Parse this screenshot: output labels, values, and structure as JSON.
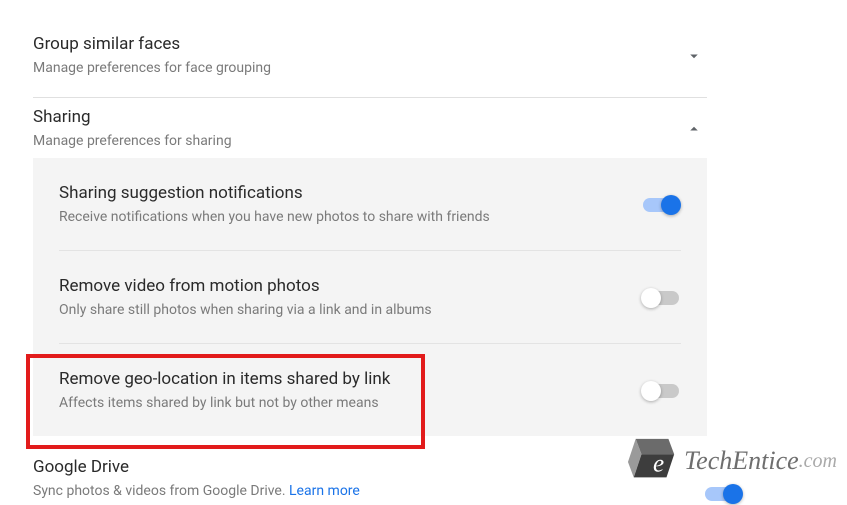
{
  "faces": {
    "title": "Group similar faces",
    "subtitle": "Manage preferences for face grouping"
  },
  "sharing": {
    "title": "Sharing",
    "subtitle": "Manage preferences for sharing",
    "items": [
      {
        "title": "Sharing suggestion notifications",
        "subtitle": "Receive notifications when you have new photos to share with friends",
        "on": true
      },
      {
        "title": "Remove video from motion photos",
        "subtitle": "Only share still photos when sharing via a link and in albums",
        "on": false
      },
      {
        "title": "Remove geo-location in items shared by link",
        "subtitle": "Affects items shared by link but not by other means",
        "on": false
      }
    ]
  },
  "drive": {
    "title": "Google Drive",
    "subtitle_prefix": "Sync photos & videos from Google Drive. ",
    "learn_more": "Learn more",
    "on": true
  },
  "watermark": {
    "brand": "TechEntice",
    "tld": ".com"
  }
}
